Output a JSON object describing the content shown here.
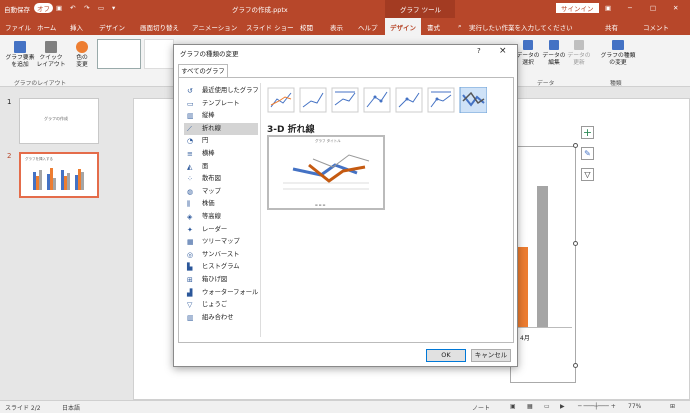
{
  "titlebar": {
    "autosave": "自動保存",
    "autosave_state": "オフ",
    "filename": "グラフの作成.pptx",
    "context_tab": "グラフ ツール",
    "signin": "サインイン"
  },
  "menu": {
    "file": "ファイル",
    "home": "ホーム",
    "insert": "挿入",
    "design": "デザイン",
    "transitions": "画面切り替え",
    "animations": "アニメーション",
    "slideshow": "スライド ショー",
    "review": "校閲",
    "view": "表示",
    "help": "ヘルプ",
    "chart_design": "デザイン",
    "format": "書式",
    "tellme": "実行したい作業を入力してください",
    "share": "共有",
    "comments": "コメント"
  },
  "ribbon": {
    "add_element": "グラフ要素\nを追加",
    "quick_layout": "クイック\nレイアウト",
    "change_colors": "色の\n変更",
    "group_layout": "グラフのレイアウト",
    "switch_rowcol": "行/列の\n切り替え",
    "select_data": "データの\n選択",
    "edit_data": "データの\n編集",
    "refresh_data": "データの\n更新",
    "group_data": "データ",
    "change_type": "グラフの種類\nの変更",
    "group_type": "種類"
  },
  "slides": {
    "num1": "1",
    "num2": "2",
    "s1_title": "グラフの作成",
    "s2_title": "グラフを挿入する"
  },
  "dialog": {
    "title": "グラフの種類の変更",
    "help": "?",
    "close": "×",
    "tab_all": "すべてのグラフ",
    "heading": "3-D 折れ線",
    "preview_title": "グラフ タイトル",
    "ok": "OK",
    "cancel": "キャンセル",
    "categories": [
      "最近使用したグラフ",
      "テンプレート",
      "縦棒",
      "折れ線",
      "円",
      "横棒",
      "面",
      "散布図",
      "マップ",
      "株価",
      "等高線",
      "レーダー",
      "ツリーマップ",
      "サンバースト",
      "ヒストグラム",
      "箱ひげ図",
      "ウォーターフォール",
      "じょうご",
      "組み合わせ"
    ],
    "selected_category": 3
  },
  "chart": {
    "category_label": "4月",
    "bar_color": "#ed7d31",
    "bar2_color": "#a5a5a5"
  },
  "status": {
    "slide": "スライド 2/2",
    "lang": "日本語",
    "notes": "ノート",
    "zoom": "77%"
  },
  "colors": {
    "accent": "#b7472a",
    "blue": "#4472c4",
    "orange": "#ed7d31",
    "gray": "#a5a5a5"
  }
}
